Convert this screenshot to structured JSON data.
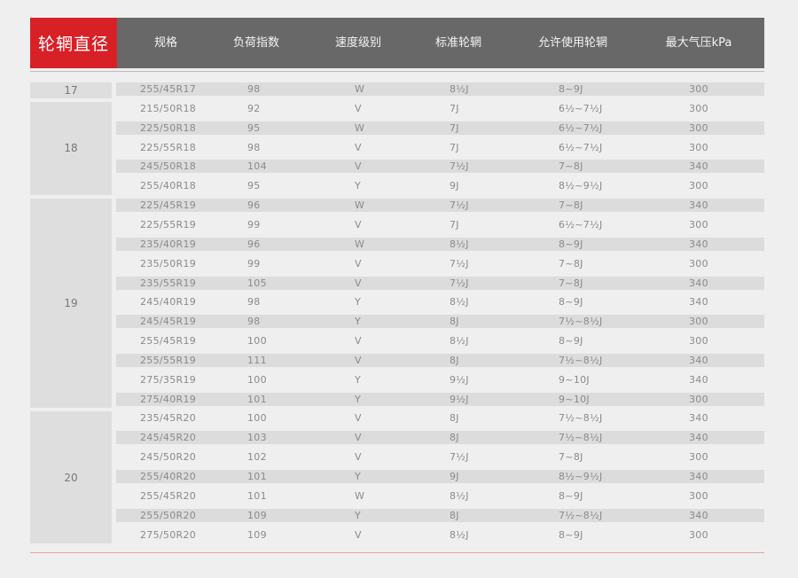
{
  "header": {
    "rim_diameter": "轮辋直径",
    "columns": [
      "规格",
      "负荷指数",
      "速度级别",
      "标准轮辋",
      "允许使用轮辋",
      "最大气压kPa"
    ]
  },
  "groups": [
    {
      "label": "17",
      "rows": [
        [
          "255/45R17",
          "98",
          "W",
          "8½J",
          "8~9J",
          "300"
        ]
      ]
    },
    {
      "label": "18",
      "rows": [
        [
          "215/50R18",
          "92",
          "V",
          "7J",
          "6½~7½J",
          "300"
        ],
        [
          "225/50R18",
          "95",
          "W",
          "7J",
          "6½~7½J",
          "300"
        ],
        [
          "225/55R18",
          "98",
          "V",
          "7J",
          "6½~7½J",
          "300"
        ],
        [
          "245/50R18",
          "104",
          "V",
          "7½J",
          "7~8J",
          "340"
        ],
        [
          "255/40R18",
          "95",
          "Y",
          "9J",
          "8½~9½J",
          "300"
        ]
      ]
    },
    {
      "label": "19",
      "rows": [
        [
          "225/45R19",
          "96",
          "W",
          "7½J",
          "7~8J",
          "340"
        ],
        [
          "225/55R19",
          "99",
          "V",
          "7J",
          "6½~7½J",
          "300"
        ],
        [
          "235/40R19",
          "96",
          "W",
          "8½J",
          "8~9J",
          "340"
        ],
        [
          "235/50R19",
          "99",
          "V",
          "7½J",
          "7~8J",
          "300"
        ],
        [
          "235/55R19",
          "105",
          "V",
          "7½J",
          "7~8J",
          "340"
        ],
        [
          "245/40R19",
          "98",
          "Y",
          "8½J",
          "8~9J",
          "340"
        ],
        [
          "245/45R19",
          "98",
          "Y",
          "8J",
          "7½~8½J",
          "300"
        ],
        [
          "255/45R19",
          "100",
          "V",
          "8½J",
          "8~9J",
          "300"
        ],
        [
          "255/55R19",
          "111",
          "V",
          "8J",
          "7½~8½J",
          "340"
        ],
        [
          "275/35R19",
          "100",
          "Y",
          "9½J",
          "9~10J",
          "340"
        ],
        [
          "275/40R19",
          "101",
          "Y",
          "9½J",
          "9~10J",
          "300"
        ]
      ]
    },
    {
      "label": "20",
      "rows": [
        [
          "235/45R20",
          "100",
          "V",
          "8J",
          "7½~8½J",
          "340"
        ],
        [
          "245/45R20",
          "103",
          "V",
          "8J",
          "7½~8½J",
          "340"
        ],
        [
          "245/50R20",
          "102",
          "V",
          "7½J",
          "7~8J",
          "300"
        ],
        [
          "255/40R20",
          "101",
          "Y",
          "9J",
          "8½~9½J",
          "340"
        ],
        [
          "255/45R20",
          "101",
          "W",
          "8½J",
          "8~9J",
          "300"
        ],
        [
          "255/50R20",
          "109",
          "Y",
          "8J",
          "7½~8½J",
          "340"
        ],
        [
          "275/50R20",
          "109",
          "V",
          "8½J",
          "8~9J",
          "300"
        ]
      ]
    }
  ]
}
